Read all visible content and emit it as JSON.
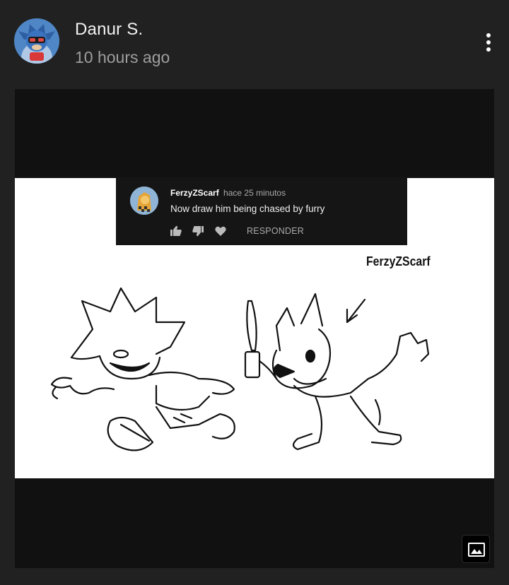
{
  "post": {
    "author": "Danur S.",
    "timestamp": "10 hours ago",
    "avatar_icon": "sonic-character-avatar",
    "menu_icon": "more-vertical-icon"
  },
  "image": {
    "embedded_comment": {
      "username": "FerzyZScarf",
      "time": "hace 25 minutos",
      "text": "Now draw him being chased by furry",
      "reply_label": "RESPONDER",
      "icons": [
        "thumbs-up-icon",
        "thumbs-down-icon",
        "heart-icon"
      ]
    },
    "signature": "FerzyZScarf",
    "gallery_icon": "image-gallery-icon"
  },
  "colors": {
    "background": "#212121",
    "card_background": "#111111",
    "secondary_text": "#9e9e9e"
  }
}
